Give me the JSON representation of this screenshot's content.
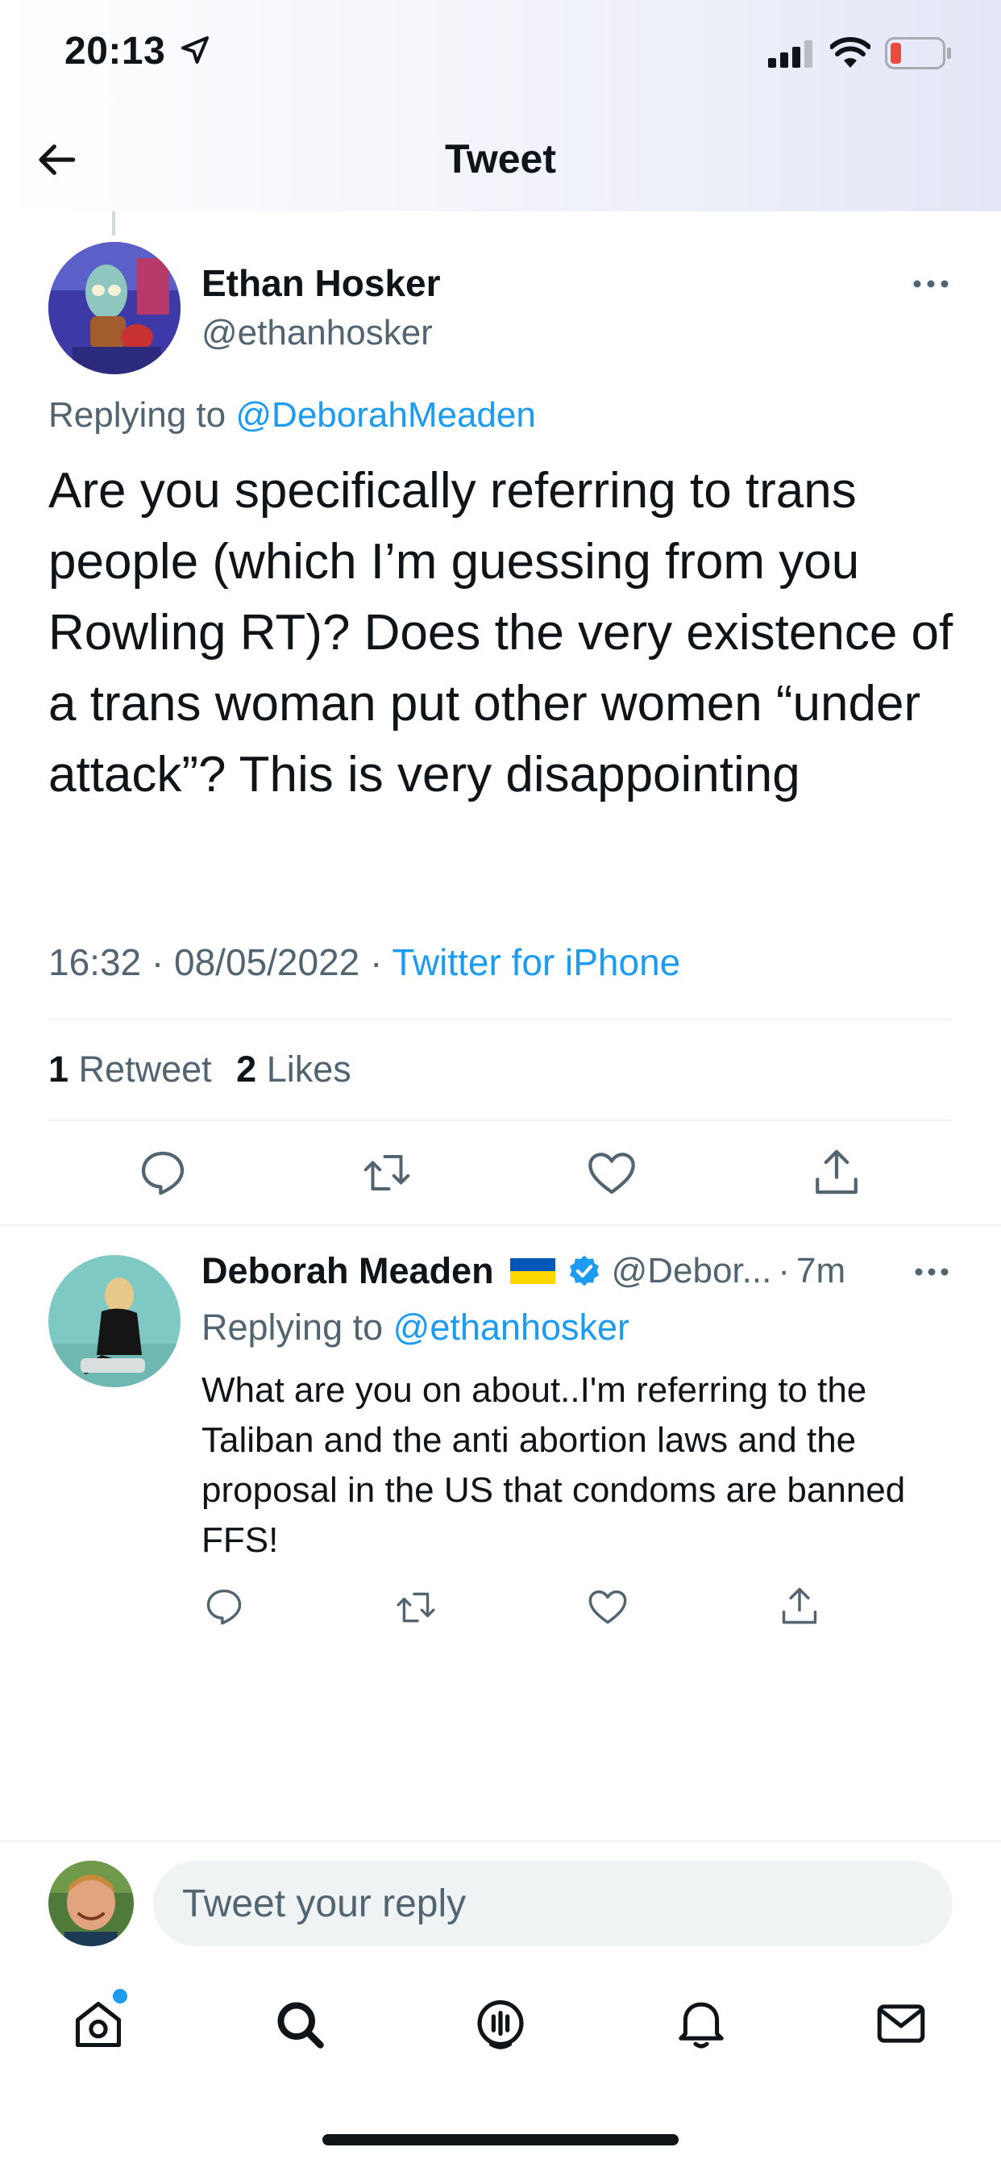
{
  "status_bar": {
    "time": "20:13"
  },
  "header": {
    "title": "Tweet"
  },
  "main_tweet": {
    "author_name": "Ethan Hosker",
    "author_handle": "@ethanhosker",
    "replying_prefix": "Replying to",
    "replying_to": "@DeborahMeaden",
    "text": "Are you specifically referring to trans people (which I’m guessing from you Rowling RT)? Does the very existence of a trans woman put other women “under attack”? This is very disappointing",
    "time": "16:32",
    "date": "08/05/2022",
    "source": "Twitter for iPhone",
    "retweet_count": "1",
    "retweet_label": "Retweet",
    "like_count": "2",
    "like_label": "Likes"
  },
  "reply_tweet": {
    "author_name": "Deborah Meaden",
    "flag": "🇺🇦",
    "author_handle": "@Debor...",
    "age": "7m",
    "replying_prefix": "Replying to",
    "replying_to": "@ethanhosker",
    "text": "What are you on about..I'm referring to the Taliban and the anti abortion laws and the proposal in the US that condoms are banned FFS!"
  },
  "reply_bar": {
    "placeholder": "Tweet your reply"
  },
  "icons": {
    "back": "arrow-left-icon",
    "more": "more-dots-icon",
    "reply": "reply-icon",
    "retweet": "retweet-icon",
    "like": "heart-icon",
    "share": "share-icon",
    "verified": "verified-badge-icon",
    "tabs": [
      "home-icon",
      "search-icon",
      "spaces-icon",
      "notifications-icon",
      "messages-icon"
    ]
  },
  "colors": {
    "accent": "#1d9bf0",
    "text": "#0f1419",
    "secondary": "#536471",
    "divider": "#eff3f4",
    "battery_low": "#eb4b3f",
    "ukraine_blue": "#0057b7",
    "ukraine_yellow": "#ffd700"
  }
}
